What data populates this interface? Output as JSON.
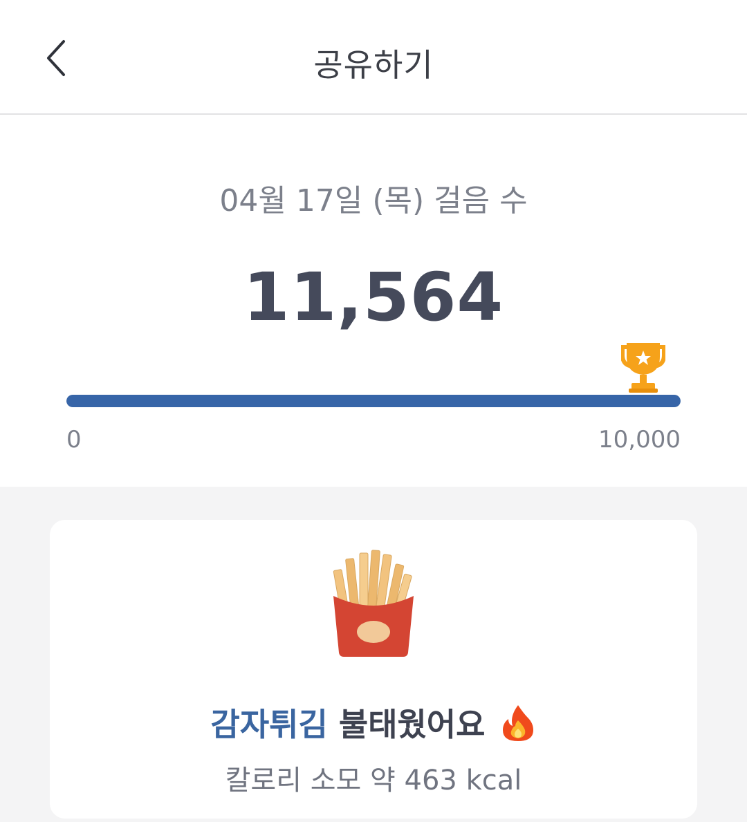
{
  "header": {
    "title": "공유하기",
    "back_icon": "chevron-left-icon"
  },
  "stats": {
    "date_label": "04월 17일 (목) 걸음 수",
    "step_count": "11,564",
    "goal_icon": "trophy-icon",
    "progress": {
      "current": 11564,
      "goal": 10000,
      "fraction": 1.0,
      "min_label": "0",
      "max_label": "10,000"
    }
  },
  "card": {
    "image_icon": "french-fries-icon",
    "food_name": "감자튀김",
    "burn_text": "불태웠어요",
    "flame_icon": "fire-icon",
    "calorie_text": "칼로리 소모 약 463 kcal"
  },
  "colors": {
    "accent": "#3765a8",
    "food_text": "#3a65a0",
    "trophy": "#f6a21a",
    "fries_box": "#d44533",
    "background": "#f4f4f5"
  }
}
